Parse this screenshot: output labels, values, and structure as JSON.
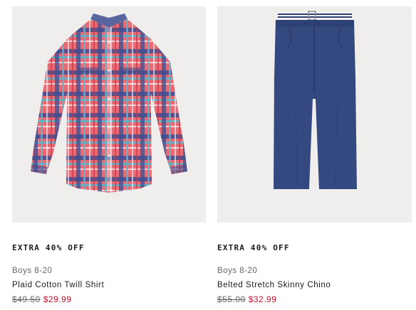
{
  "products": [
    {
      "image_alt": "plaid-shirt",
      "promo": "EXTRA 40% OFF",
      "category": "Boys 8-20",
      "name": "Plaid Cotton Twill Shirt",
      "original_price": "$49.50",
      "sale_price": "$29.99"
    },
    {
      "image_alt": "navy-chino",
      "promo": "EXTRA 40% OFF",
      "category": "Boys 8-20",
      "name": "Belted Stretch Skinny Chino",
      "original_price": "$55.00",
      "sale_price": "$32.99"
    }
  ],
  "colors": {
    "image_bg": "#efeeed",
    "sale": "#c8102e",
    "strike": "#666666",
    "shirt_red": "#e65a66",
    "shirt_blue": "#3e4d8f",
    "chino_navy": "#33497f"
  }
}
